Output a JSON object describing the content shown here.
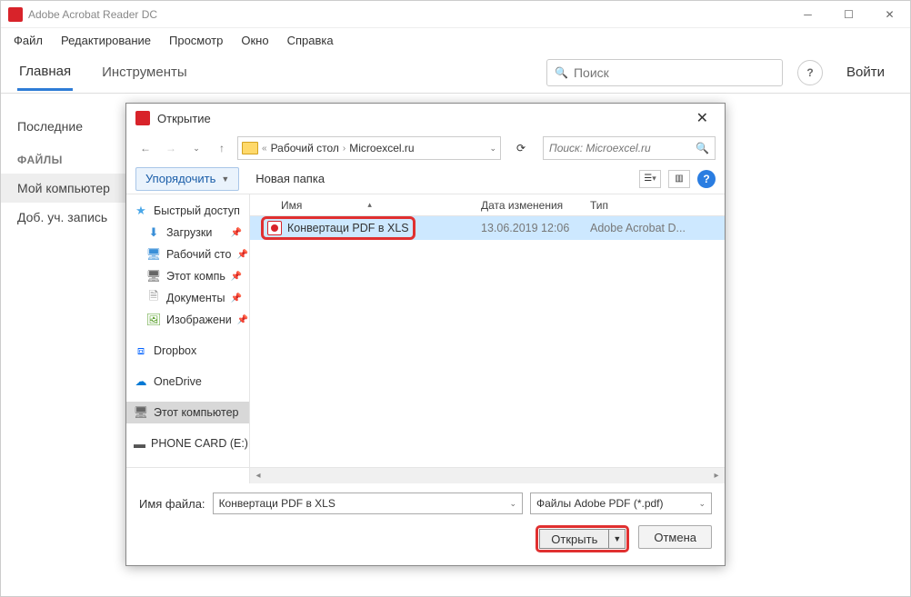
{
  "app": {
    "title": "Adobe Acrobat Reader DC",
    "menu": [
      "Файл",
      "Редактирование",
      "Просмотр",
      "Окно",
      "Справка"
    ],
    "tabs": {
      "home": "Главная",
      "tools": "Инструменты"
    },
    "search_placeholder": "Поиск",
    "signin": "Войти"
  },
  "sidebar": {
    "recent": "Последние",
    "files_heading": "ФАЙЛЫ",
    "my_computer": "Мой компьютер",
    "add_account": "Доб. уч. запись"
  },
  "dialog": {
    "title": "Открытие",
    "path": {
      "sep": "«",
      "seg1": "Рабочий стол",
      "arrow": "›",
      "seg2": "Microexcel.ru"
    },
    "search_placeholder": "Поиск: Microexcel.ru",
    "organize": "Упорядочить",
    "new_folder": "Новая папка",
    "columns": {
      "name": "Имя",
      "date": "Дата изменения",
      "type": "Тип"
    },
    "tree": {
      "quick": "Быстрый доступ",
      "downloads": "Загрузки",
      "desktop": "Рабочий сто",
      "thispc_short": "Этот компь",
      "documents": "Документы",
      "images": "Изображени",
      "dropbox": "Dropbox",
      "onedrive": "OneDrive",
      "thispc": "Этот компьютер",
      "phone": "PHONE CARD (E:)"
    },
    "file": {
      "name": "Конвертаци PDF в XLS",
      "date": "13.06.2019 12:06",
      "type": "Adobe Acrobat D..."
    },
    "filename_label": "Имя файла:",
    "filename_value": "Конвертаци PDF в XLS",
    "filetype": "Файлы Adobe PDF (*.pdf)",
    "open_btn": "Открыть",
    "cancel_btn": "Отмена"
  }
}
